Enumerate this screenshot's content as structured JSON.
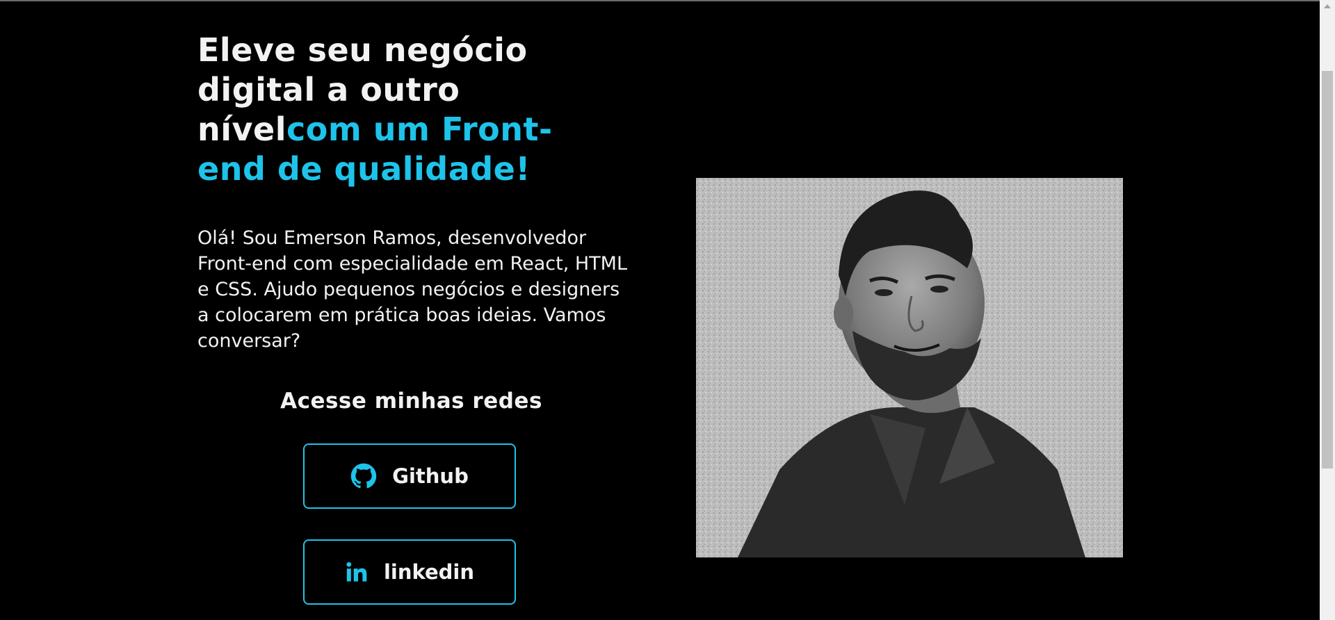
{
  "hero": {
    "title_line1": "Eleve seu negócio",
    "title_line2": "digital a outro",
    "title_line3_plain": "nível",
    "title_line3_accent": "com um Front-",
    "title_line4_accent": "end de qualidade!",
    "intro": "Olá! Sou Emerson Ramos, desenvolvedor Front-end com especialidade em React, HTML e CSS. Ajudo pequenos negócios e designers a colocarem em prática boas ideias. Vamos conversar?"
  },
  "social": {
    "title": "Acesse minhas redes",
    "buttons": [
      {
        "label": "Github",
        "icon": "github-icon"
      },
      {
        "label": "linkedin",
        "icon": "linkedin-icon"
      }
    ]
  },
  "photo": {
    "alt": "portrait-photo"
  },
  "colors": {
    "background": "#000000",
    "text": "#f2f2f2",
    "accent": "#1ec3ea"
  }
}
